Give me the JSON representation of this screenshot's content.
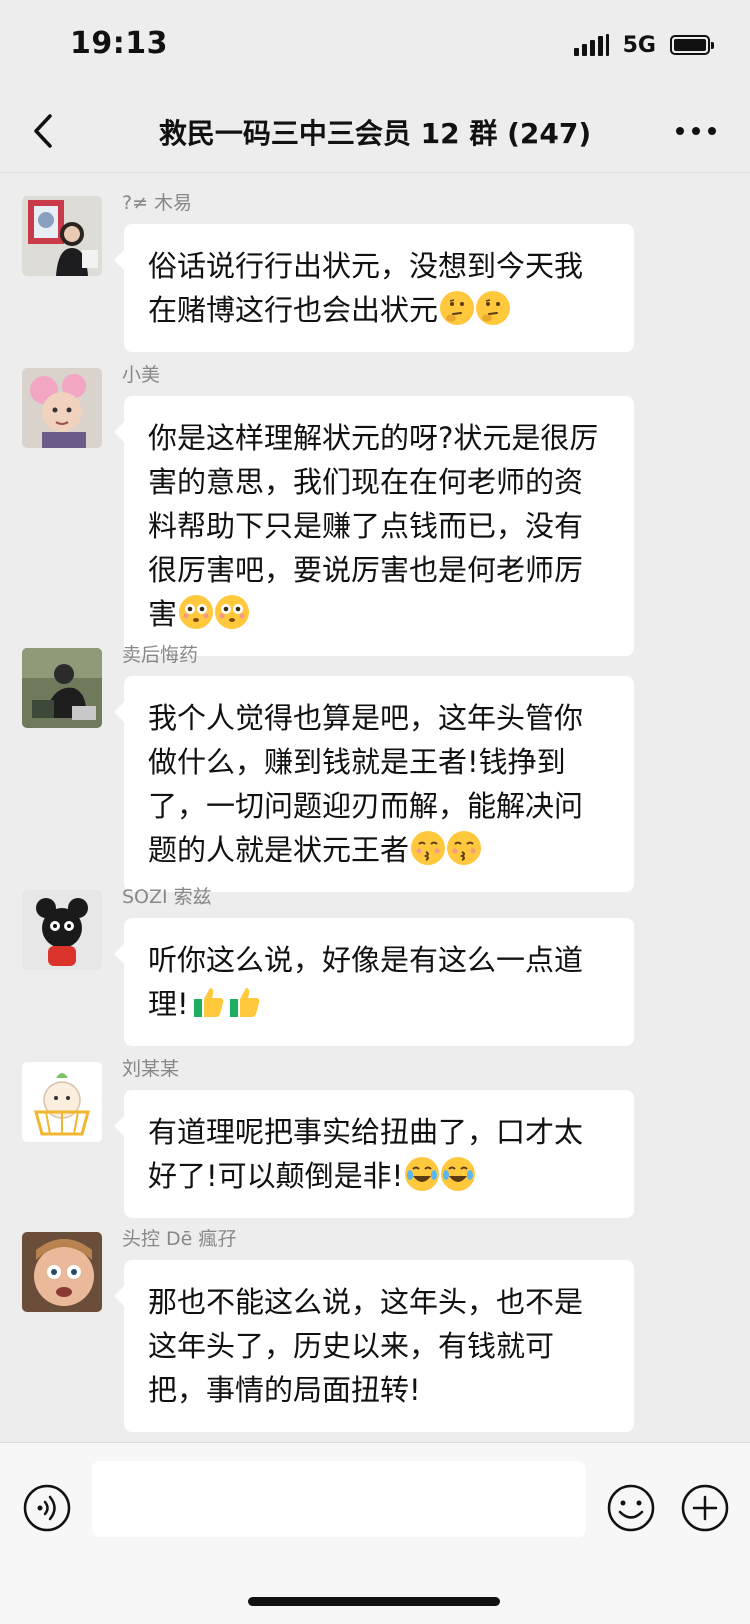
{
  "status_bar": {
    "time": "19:13",
    "network": "5G"
  },
  "header": {
    "title": "救民一码三中三会员 12 群 (247)"
  },
  "messages": [
    {
      "sender": "?≠ 木易",
      "text": "俗话说行行出状元，没想到今天我在赌博这行也会出状元",
      "emoji": "thinking-face-emoji",
      "emoji_count": 2
    },
    {
      "sender": "小美",
      "text": "你是这样理解状元的呀?状元是很厉害的意思，我们现在在何老师的资料帮助下只是赚了点钱而已，没有很厉害吧，要说厉害也是何老师厉害",
      "emoji": "flushed-face-emoji",
      "emoji_count": 2
    },
    {
      "sender": "卖后悔药",
      "text": "我个人觉得也算是吧，这年头管你做什么，赚到钱就是王者!钱挣到了，一切问题迎刃而解，能解决问题的人就是状元王者",
      "emoji": "kissing-face-emoji",
      "emoji_count": 2
    },
    {
      "sender": "SOZI 索兹",
      "text": "听你这么说，好像是有这么一点道理!",
      "emoji": "thumbs-up-emoji",
      "emoji_count": 2
    },
    {
      "sender": "刘某某",
      "text": "有道理呢把事实给扭曲了，口才太好了!可以颠倒是非!",
      "emoji": "tears-of-joy-emoji",
      "emoji_count": 2
    },
    {
      "sender": "头控 Dē 瘋孖",
      "text": "那也不能这么说，这年头，也不是这年头了，历史以来，有钱就可把，事情的局面扭转!",
      "emoji": "",
      "emoji_count": 0
    }
  ],
  "input": {
    "placeholder": "",
    "value": ""
  },
  "colors": {
    "background": "#ededed",
    "bubble": "#ffffff",
    "sender_name": "#888888",
    "emoji_yellow": "#ffc83d",
    "thumbs_green": "#1fae5f"
  }
}
